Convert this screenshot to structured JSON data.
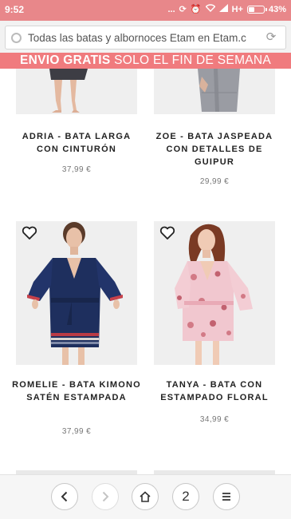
{
  "status_bar": {
    "time": "9:52",
    "notification_dots": "...",
    "network": "H+",
    "battery": "43%",
    "battery_level": 0.43,
    "icons": [
      "sync-icon",
      "alarm-icon",
      "wifi-icon",
      "signal-icon",
      "battery-icon"
    ]
  },
  "browser": {
    "url_text": "Todas las batas y albornoces Etam en Etam.c",
    "site_icon": "globe-icon",
    "reload_icon": "reload-icon"
  },
  "promo": {
    "bold": "ENVIO GRATIS",
    "rest": " SOLO EL FIN DE SEMANA",
    "color": "#f07b7e"
  },
  "products": [
    {
      "name": "ADRIA - BATA LARGA CON CINTURÓN",
      "price": "37,99 €",
      "wishlist": false,
      "robe_color": "#3d3d44"
    },
    {
      "name": "ZOE - BATA JASPEADA CON DETALLES DE GUIPUR",
      "price": "29,99 €",
      "wishlist": false,
      "robe_color": "#9a9ca3"
    },
    {
      "name": "ROMELIE - BATA KIMONO SATÉN ESTAMPADA",
      "price": "37,99 €",
      "wishlist": true,
      "robe_color": "#1e2f5e"
    },
    {
      "name": "TANYA - BATA CON ESTAMPADO FLORAL",
      "price": "34,99 €",
      "wishlist": true,
      "robe_color": "#f1c7cf"
    }
  ],
  "bottom_nav": {
    "back_icon": "chevron-left-icon",
    "forward_icon": "chevron-right-icon",
    "home_icon": "home-icon",
    "tab_count": "2",
    "menu_icon": "menu-icon"
  }
}
